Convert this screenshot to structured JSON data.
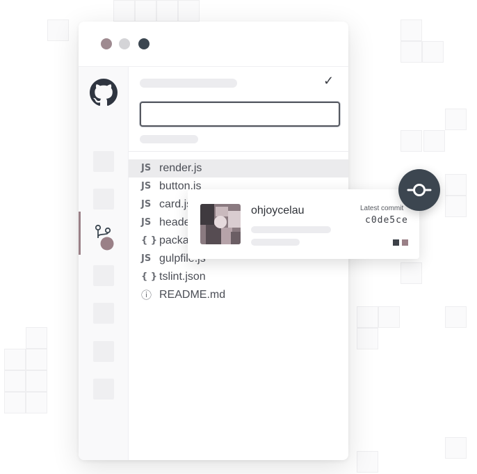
{
  "window": {
    "traffic_colors": [
      "#9e8a90",
      "#d4d4d7",
      "#3b4650"
    ]
  },
  "sidebar": {
    "items": [
      {
        "icon": "github-mark-icon"
      },
      {
        "icon": "placeholder"
      },
      {
        "icon": "placeholder"
      },
      {
        "icon": "branch-icon"
      },
      {
        "icon": "placeholder"
      },
      {
        "icon": "placeholder"
      },
      {
        "icon": "placeholder"
      },
      {
        "icon": "placeholder"
      }
    ]
  },
  "files": [
    {
      "type": "JS",
      "name": "render.js",
      "selected": true
    },
    {
      "type": "JS",
      "name": "button.js"
    },
    {
      "type": "JS",
      "name": "card.js"
    },
    {
      "type": "JS",
      "name": "header.js"
    },
    {
      "type": "{ }",
      "name": "package.json"
    },
    {
      "type": "JS",
      "name": "gulpfile.js"
    },
    {
      "type": "{ }",
      "name": "tslint.json"
    },
    {
      "type": "ⓘ",
      "name": "README.md"
    }
  ],
  "popup": {
    "username": "ohjoycelau",
    "latest_label": "Latest commit",
    "commit_hash": "c0de5ce",
    "swatches": [
      "#3d4148",
      "#9a8087"
    ]
  },
  "accent": "#3c4650"
}
